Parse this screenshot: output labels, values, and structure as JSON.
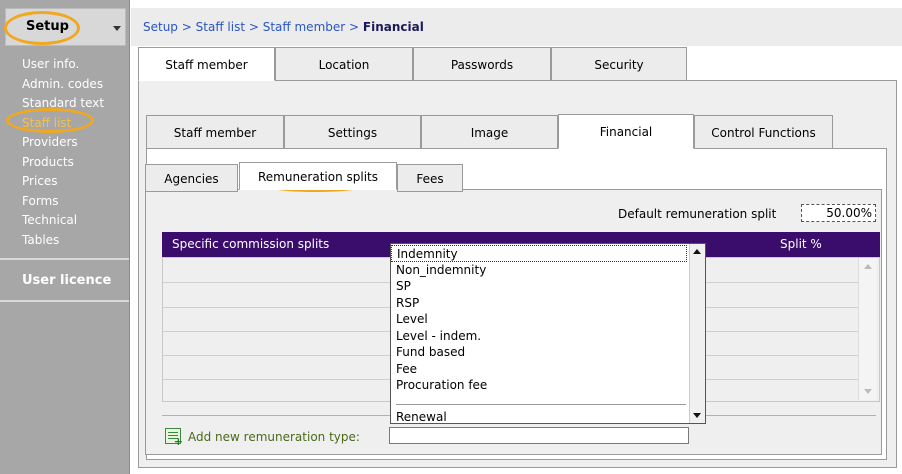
{
  "sidebar": {
    "title": "Setup",
    "items": [
      {
        "label": "User info."
      },
      {
        "label": "Admin. codes"
      },
      {
        "label": "Standard text"
      },
      {
        "label": "Staff list",
        "active": true
      },
      {
        "label": "Providers"
      },
      {
        "label": "Products"
      },
      {
        "label": "Prices"
      },
      {
        "label": "Forms"
      },
      {
        "label": "Technical"
      },
      {
        "label": "Tables"
      }
    ],
    "user_licence": "User licence"
  },
  "breadcrumb": {
    "parts": [
      "Setup",
      "Staff list",
      "Staff member"
    ],
    "separator": ">",
    "current": "Financial"
  },
  "main_tabs": [
    "Staff member",
    "Location",
    "Passwords",
    "Security"
  ],
  "sub_tabs": [
    "Staff member",
    "Settings",
    "Image",
    "Financial",
    "Control Functions"
  ],
  "section_tabs": [
    "Agencies",
    "Remuneration splits",
    "Fees"
  ],
  "default_split": {
    "label": "Default remuneration split",
    "value": "50.00%"
  },
  "grid": {
    "col1": "Specific commission splits",
    "col2": "Split %"
  },
  "dropdown": {
    "options": [
      "Indemnity",
      "Non_indemnity",
      "SP",
      "RSP",
      "Level",
      "Level - indem.",
      "Fund based",
      "Fee",
      "Procuration fee"
    ],
    "after_divider": "Renewal"
  },
  "add": {
    "label": "Add new remuneration type:",
    "value": ""
  },
  "colors": {
    "header_bg": "#3a0c6b",
    "highlight": "#f0a820",
    "link": "#2a55c0"
  }
}
